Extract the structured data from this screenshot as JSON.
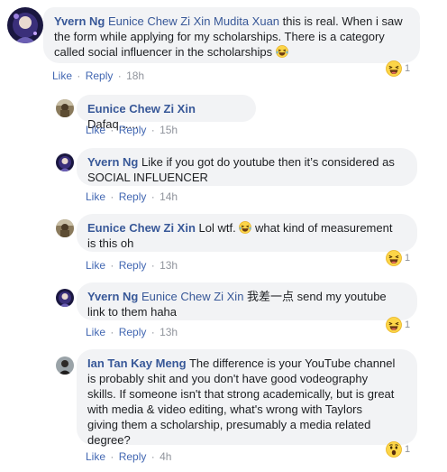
{
  "comments": [
    {
      "author": "Yvern Ng",
      "mentions": "Eunice Chew Zi Xin Mudita Xuan",
      "text_line1_rest": " this is real. When i saw",
      "text_line2": "the form while applying for my scholarships. There is a category",
      "text_line3": "called social influencer in the scholarships",
      "like": "Like",
      "reply": "Reply",
      "time": "18h",
      "reaction_count": "1",
      "reaction_type": "haha"
    },
    {
      "author": "Eunice Chew Zi Xin",
      "text": "Dafaq......",
      "like": "Like",
      "reply": "Reply",
      "time": "15h"
    },
    {
      "author": "Yvern Ng",
      "text_line1": "Like if you got do youtube then it’s considered as",
      "text_line2": "SOCIAL INFLUENCER",
      "like": "Like",
      "reply": "Reply",
      "time": "14h"
    },
    {
      "author": "Eunice Chew Zi Xin",
      "text_line1_a": "Lol wtf.",
      "text_line1_b": "what kind of measurement",
      "text_line2": "is this oh",
      "like": "Like",
      "reply": "Reply",
      "time": "13h",
      "reaction_count": "1",
      "reaction_type": "haha"
    },
    {
      "author": "Yvern Ng",
      "mention": "Eunice Chew Zi Xin",
      "text_line1_rest": " 我差一点 send my youtube",
      "text_line2": "link to them haha",
      "like": "Like",
      "reply": "Reply",
      "time": "13h",
      "reaction_count": "1",
      "reaction_type": "haha"
    },
    {
      "author": "Ian Tan Kay Meng",
      "text_line1": "The difference is your YouTube channel",
      "text_line2": "is probably shit and you don't have good vodeography",
      "text_line3": "skills. If someone isn't that strong academically, but is great",
      "text_line4": "with media & video editing, what's wrong with Taylors",
      "text_line5": "giving them a scholarship, presumably a media related",
      "text_line6": "degree?",
      "like": "Like",
      "reply": "Reply",
      "time": "4h",
      "reaction_count": "1",
      "reaction_type": "wow"
    }
  ],
  "separator": "·",
  "colors": {
    "link_blue": "#385898",
    "action_blue": "#4267b2",
    "bubble_bg": "#f2f3f5",
    "meta_gray": "#90949c"
  }
}
